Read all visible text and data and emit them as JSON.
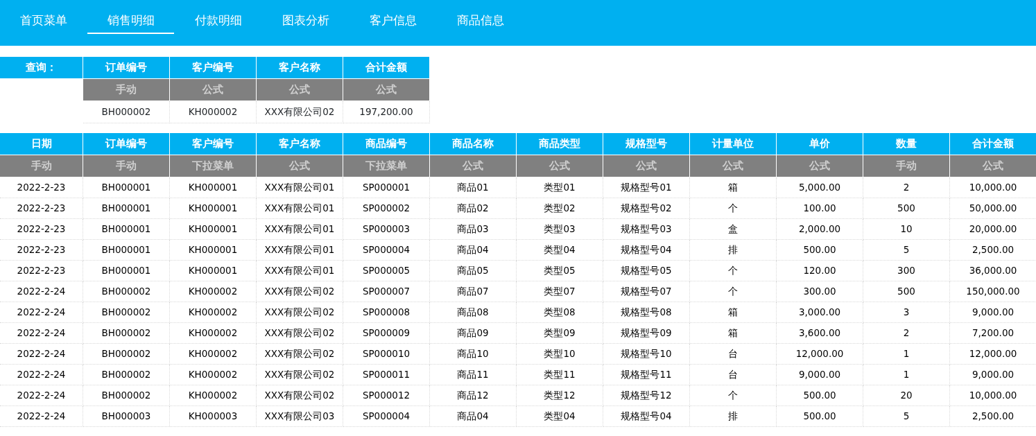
{
  "nav": [
    {
      "label": "首页菜单",
      "selected": false
    },
    {
      "label": "销售明细",
      "selected": true
    },
    {
      "label": "付款明细",
      "selected": false
    },
    {
      "label": "图表分析",
      "selected": false
    },
    {
      "label": "客户信息",
      "selected": false
    },
    {
      "label": "商品信息",
      "selected": false
    }
  ],
  "query": {
    "label": "查询：",
    "columns": [
      "订单编号",
      "客户编号",
      "客户名称",
      "合计金额"
    ],
    "modes": [
      "手动",
      "公式",
      "公式",
      "公式"
    ],
    "values": [
      "BH000002",
      "KH000002",
      "XXX有限公司02",
      "197,200.00"
    ]
  },
  "table": {
    "columns": [
      "日期",
      "订单编号",
      "客户编号",
      "客户名称",
      "商品编号",
      "商品名称",
      "商品类型",
      "规格型号",
      "计量单位",
      "单价",
      "数量",
      "合计金额"
    ],
    "modes": [
      "手动",
      "手动",
      "下拉菜单",
      "公式",
      "下拉菜单",
      "公式",
      "公式",
      "公式",
      "公式",
      "公式",
      "手动",
      "公式"
    ],
    "rows": [
      [
        "2022-2-23",
        "BH000001",
        "KH000001",
        "XXX有限公司01",
        "SP000001",
        "商品01",
        "类型01",
        "规格型号01",
        "箱",
        "5,000.00",
        "2",
        "10,000.00"
      ],
      [
        "2022-2-23",
        "BH000001",
        "KH000001",
        "XXX有限公司01",
        "SP000002",
        "商品02",
        "类型02",
        "规格型号02",
        "个",
        "100.00",
        "500",
        "50,000.00"
      ],
      [
        "2022-2-23",
        "BH000001",
        "KH000001",
        "XXX有限公司01",
        "SP000003",
        "商品03",
        "类型03",
        "规格型号03",
        "盒",
        "2,000.00",
        "10",
        "20,000.00"
      ],
      [
        "2022-2-23",
        "BH000001",
        "KH000001",
        "XXX有限公司01",
        "SP000004",
        "商品04",
        "类型04",
        "规格型号04",
        "排",
        "500.00",
        "5",
        "2,500.00"
      ],
      [
        "2022-2-23",
        "BH000001",
        "KH000001",
        "XXX有限公司01",
        "SP000005",
        "商品05",
        "类型05",
        "规格型号05",
        "个",
        "120.00",
        "300",
        "36,000.00"
      ],
      [
        "2022-2-24",
        "BH000002",
        "KH000002",
        "XXX有限公司02",
        "SP000007",
        "商品07",
        "类型07",
        "规格型号07",
        "个",
        "300.00",
        "500",
        "150,000.00"
      ],
      [
        "2022-2-24",
        "BH000002",
        "KH000002",
        "XXX有限公司02",
        "SP000008",
        "商品08",
        "类型08",
        "规格型号08",
        "箱",
        "3,000.00",
        "3",
        "9,000.00"
      ],
      [
        "2022-2-24",
        "BH000002",
        "KH000002",
        "XXX有限公司02",
        "SP000009",
        "商品09",
        "类型09",
        "规格型号09",
        "箱",
        "3,600.00",
        "2",
        "7,200.00"
      ],
      [
        "2022-2-24",
        "BH000002",
        "KH000002",
        "XXX有限公司02",
        "SP000010",
        "商品10",
        "类型10",
        "规格型号10",
        "台",
        "12,000.00",
        "1",
        "12,000.00"
      ],
      [
        "2022-2-24",
        "BH000002",
        "KH000002",
        "XXX有限公司02",
        "SP000011",
        "商品11",
        "类型11",
        "规格型号11",
        "台",
        "9,000.00",
        "1",
        "9,000.00"
      ],
      [
        "2022-2-24",
        "BH000002",
        "KH000002",
        "XXX有限公司02",
        "SP000012",
        "商品12",
        "类型12",
        "规格型号12",
        "个",
        "500.00",
        "20",
        "10,000.00"
      ],
      [
        "2022-2-24",
        "BH000003",
        "KH000003",
        "XXX有限公司03",
        "SP000004",
        "商品04",
        "类型04",
        "规格型号04",
        "排",
        "500.00",
        "5",
        "2,500.00"
      ]
    ]
  }
}
